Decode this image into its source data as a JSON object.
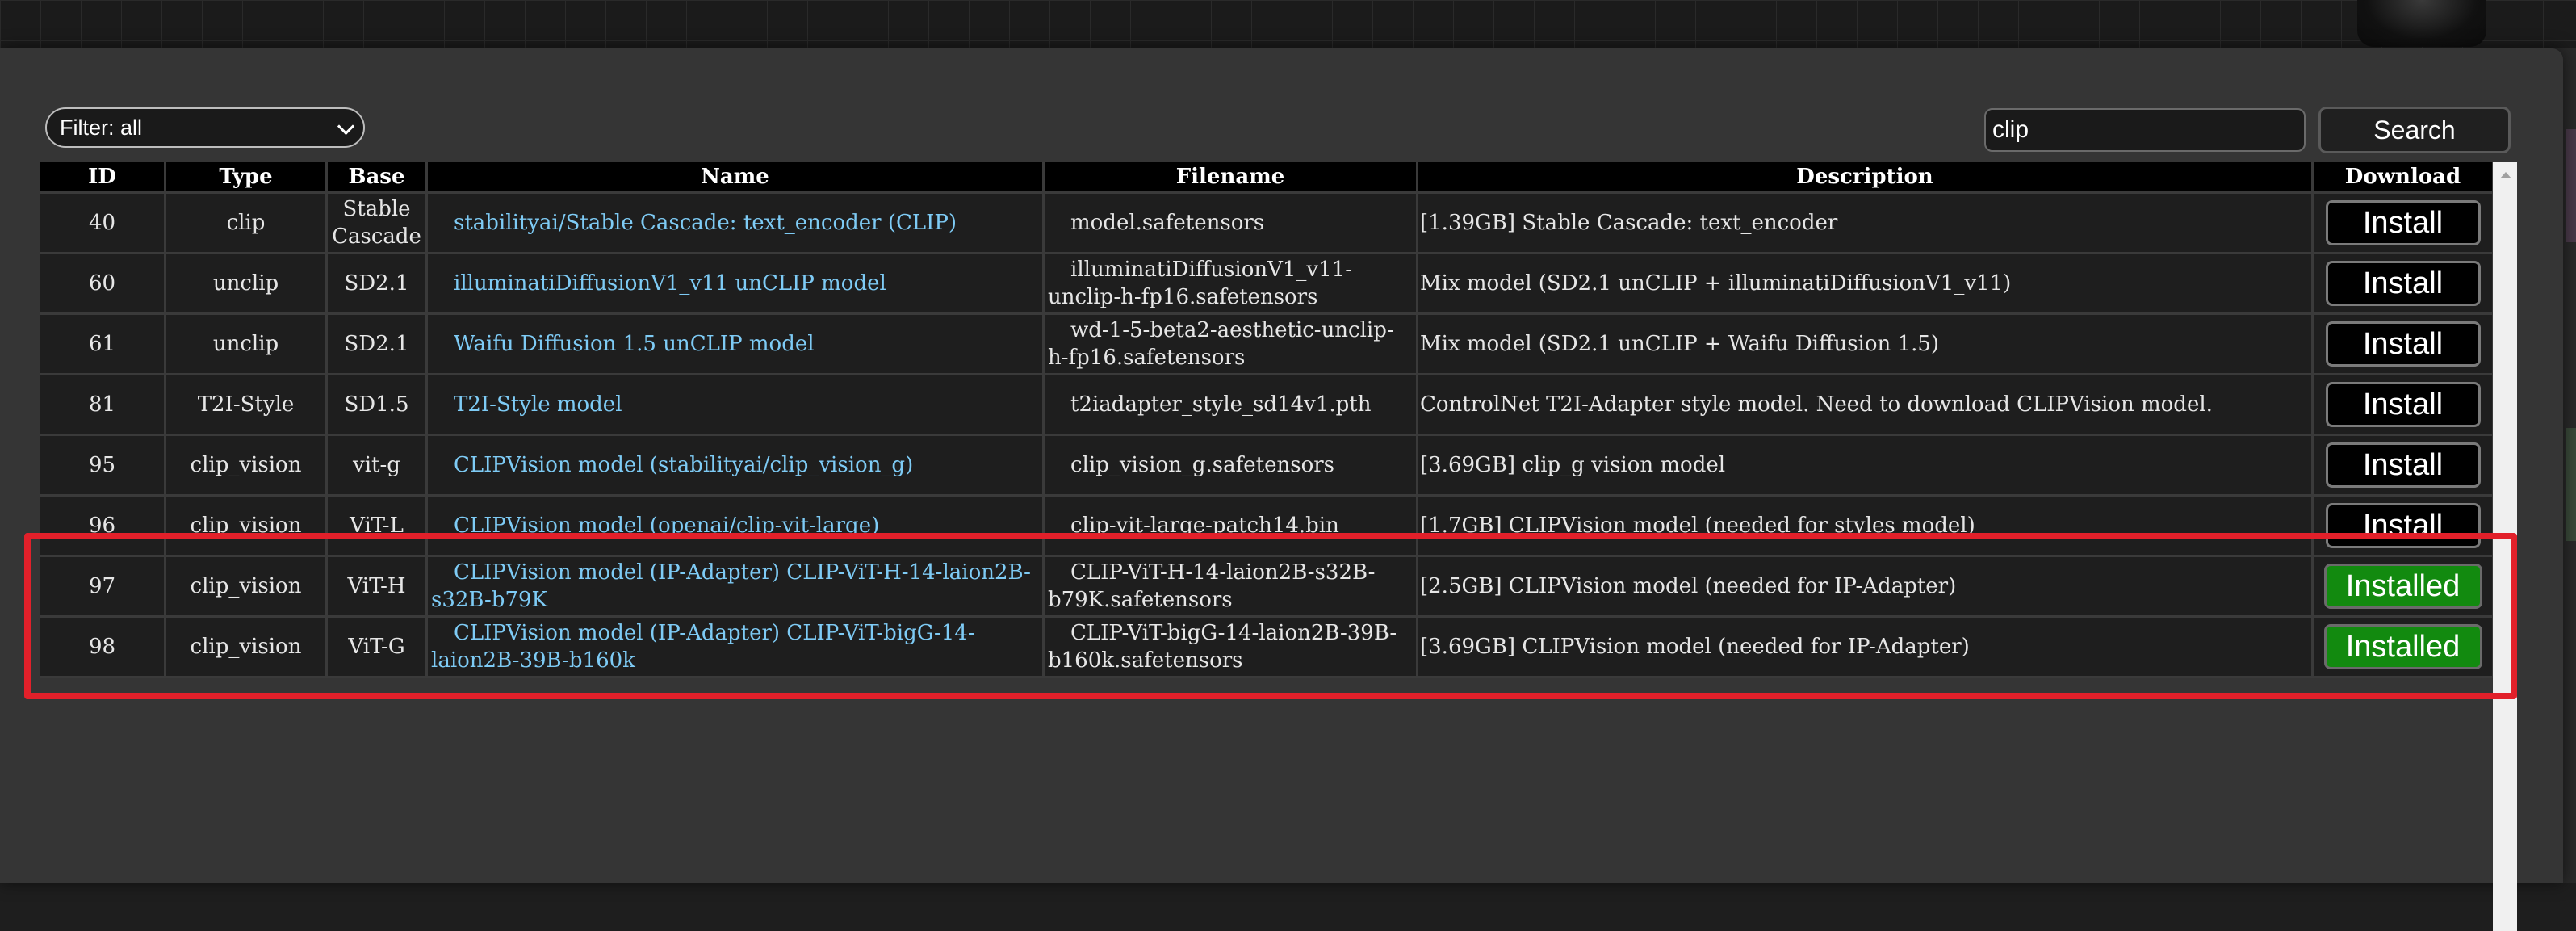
{
  "filter": {
    "selected": "Filter: all"
  },
  "search": {
    "value": "clip",
    "button_label": "Search"
  },
  "table": {
    "headers": {
      "id": "ID",
      "type": "Type",
      "base": "Base",
      "name": "Name",
      "filename": "Filename",
      "description": "Description",
      "download": "Download"
    },
    "rows": [
      {
        "id": "40",
        "type": "clip",
        "base": "Stable Cascade",
        "name": "stabilityai/Stable Cascade: text_encoder (CLIP)",
        "filename": "model.safetensors",
        "description": "[1.39GB] Stable Cascade: text_encoder",
        "action": "Install",
        "installed": false
      },
      {
        "id": "60",
        "type": "unclip",
        "base": "SD2.1",
        "name": "illuminatiDiffusionV1_v11 unCLIP model",
        "filename": "illuminatiDiffusionV1_v11-unclip-h-fp16.safetensors",
        "description": "Mix model (SD2.1 unCLIP + illuminatiDiffusionV1_v11)",
        "action": "Install",
        "installed": false
      },
      {
        "id": "61",
        "type": "unclip",
        "base": "SD2.1",
        "name": "Waifu Diffusion 1.5 unCLIP model",
        "filename": "wd-1-5-beta2-aesthetic-unclip-h-fp16.safetensors",
        "description": "Mix model (SD2.1 unCLIP + Waifu Diffusion 1.5)",
        "action": "Install",
        "installed": false
      },
      {
        "id": "81",
        "type": "T2I-Style",
        "base": "SD1.5",
        "name": "T2I-Style model",
        "filename": "t2iadapter_style_sd14v1.pth",
        "description": "ControlNet T2I-Adapter style model. Need to download CLIPVision model.",
        "action": "Install",
        "installed": false
      },
      {
        "id": "95",
        "type": "clip_vision",
        "base": "vit-g",
        "name": "CLIPVision model (stabilityai/clip_vision_g)",
        "filename": "clip_vision_g.safetensors",
        "description": "[3.69GB] clip_g vision model",
        "action": "Install",
        "installed": false
      },
      {
        "id": "96",
        "type": "clip_vision",
        "base": "ViT-L",
        "name": "CLIPVision model (openai/clip-vit-large)",
        "filename": "clip-vit-large-patch14.bin",
        "description": "[1.7GB] CLIPVision model (needed for styles model)",
        "action": "Install",
        "installed": false
      },
      {
        "id": "97",
        "type": "clip_vision",
        "base": "ViT-H",
        "name": "CLIPVision model (IP-Adapter) CLIP-ViT-H-14-laion2B-s32B-b79K",
        "filename": "CLIP-ViT-H-14-laion2B-s32B-b79K.safetensors",
        "description": "[2.5GB] CLIPVision model (needed for IP-Adapter)",
        "action": "Installed",
        "installed": true
      },
      {
        "id": "98",
        "type": "clip_vision",
        "base": "ViT-G",
        "name": "CLIPVision model (IP-Adapter) CLIP-ViT-bigG-14-laion2B-39B-b160k",
        "filename": "CLIP-ViT-bigG-14-laion2B-39B-b160k.safetensors",
        "description": "[3.69GB] CLIPVision model (needed for IP-Adapter)",
        "action": "Installed",
        "installed": true
      }
    ]
  },
  "colors": {
    "highlight": "#e2202a",
    "installed_bg": "#128a0f",
    "name_link": "#7ecbf5"
  }
}
